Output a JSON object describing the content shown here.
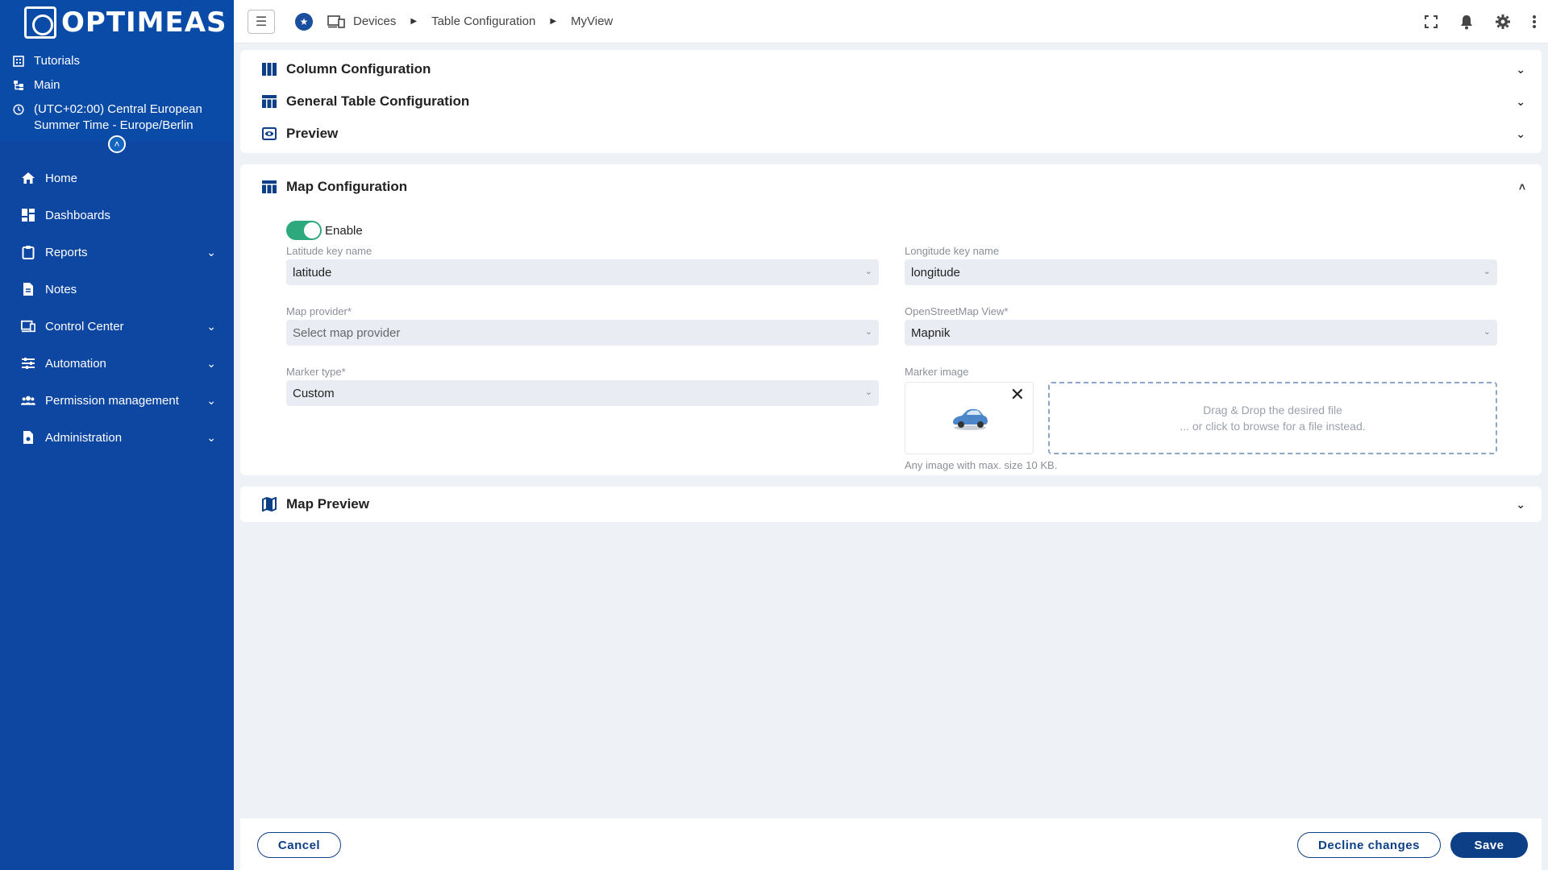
{
  "brand": {
    "logo_text": "OPTIMEAS"
  },
  "context": {
    "tutorials": "Tutorials",
    "main": "Main",
    "timezone": "(UTC+02:00) Central European Summer Time - Europe/Berlin"
  },
  "nav": {
    "home": "Home",
    "dashboards": "Dashboards",
    "reports": "Reports",
    "notes": "Notes",
    "control_center": "Control Center",
    "automation": "Automation",
    "permission_management": "Permission management",
    "administration": "Administration"
  },
  "breadcrumb": {
    "devices": "Devices",
    "table_configuration": "Table Configuration",
    "view": "MyView"
  },
  "panels": {
    "column_configuration": "Column Configuration",
    "general_table_configuration": "General Table Configuration",
    "preview": "Preview",
    "map_configuration": "Map Configuration",
    "map_preview": "Map Preview"
  },
  "map_config": {
    "enable_label": "Enable",
    "enabled": true,
    "latitude_label": "Latitude key name",
    "latitude_value": "latitude",
    "longitude_label": "Longitude key name",
    "longitude_value": "longitude",
    "provider_label": "Map provider*",
    "provider_placeholder": "Select map provider",
    "osm_view_label": "OpenStreetMap View*",
    "osm_view_value": "Mapnik",
    "marker_type_label": "Marker type*",
    "marker_type_value": "Custom",
    "marker_image_label": "Marker image",
    "dropzone_line1": "Drag & Drop the desired file",
    "dropzone_line2": "... or click to browse for a file instead.",
    "image_hint": "Any image with max. size 10 KB."
  },
  "actions": {
    "cancel": "Cancel",
    "decline": "Decline changes",
    "save": "Save"
  },
  "colors": {
    "sidebar": "#0d47a1",
    "primary": "#0d3f87",
    "toggle_on": "#2ea97d"
  }
}
